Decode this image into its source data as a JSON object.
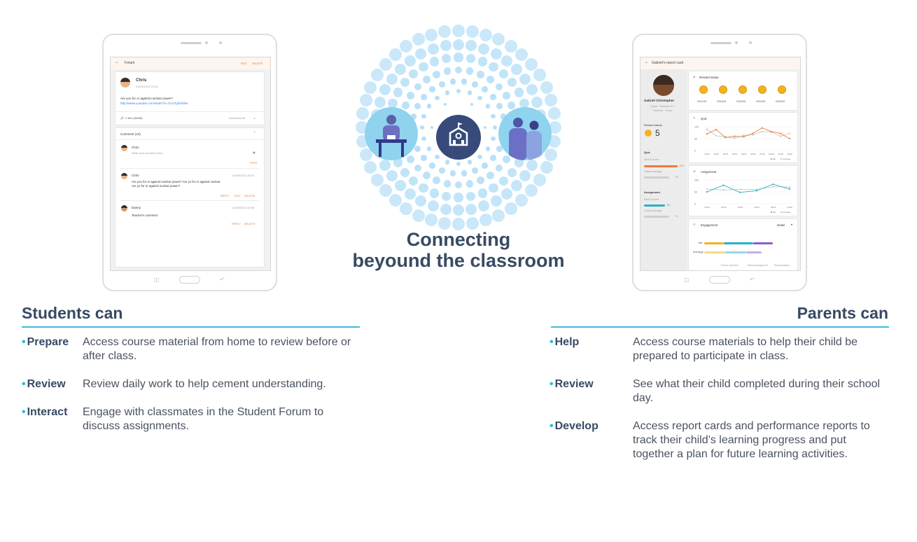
{
  "colors": {
    "accent": "#2dbbd8",
    "heading": "#374a63",
    "orange": "#e07a3f",
    "teal": "#2ab0c4"
  },
  "center": {
    "title_line1": "Connecting",
    "title_line2": "beyound the classroom",
    "icon": "school-icon"
  },
  "left_tablet": {
    "appbar": {
      "title": "Forum",
      "edit": "EDIT",
      "delete": "DELETE"
    },
    "post": {
      "author": "Chris",
      "date": "01/29/2013 19:10",
      "text": "Are you for or against nuclear power?",
      "link": "http://www.youtube.com/watch?v=GcV2ybXi00w",
      "files": "2 files (50MB)",
      "download": "Download all"
    },
    "comments": {
      "header": "Comment (10)",
      "input_name": "Chris",
      "input_placeholder": "Write your comment here",
      "post": "POST",
      "items": [
        {
          "name": "Chris",
          "date": "01/29/2013 19:10",
          "text1": "Are you for or against nuclear power? Are yo for or against nuclear",
          "text2": "Are yo for or against nuclear power?",
          "a1": "REPLY",
          "a2": "EDIT",
          "a3": "DELETE"
        },
        {
          "name": "Danny",
          "date": "01/29/2013 19:50",
          "text1": "Teacher's comment",
          "a1": "REPLY",
          "a2": "DELETE"
        }
      ]
    }
  },
  "right_tablet": {
    "appbar": {
      "title": "Gabriel's report card"
    },
    "profile": {
      "name": "Gabriel Christopher",
      "class": "Class : Science 5-1",
      "teacher": "Teacher : Chris"
    },
    "sidebar": {
      "reward_label": "Reward stamp",
      "reward_count": "5",
      "quiz_label": "Quiz",
      "alex_score": "Alex's score",
      "quiz_score": "100",
      "class_average": "Class average",
      "quiz_avg": "75",
      "assignment_label": "Assignment",
      "assign_score": "50",
      "assign_avg": "73"
    },
    "reward_card": {
      "title": "Reward stamp",
      "dates": [
        "03/14/15",
        "03/16/15",
        "03/16/15",
        "03/16/15",
        "03/16/15"
      ]
    },
    "quiz_card": {
      "title": "Quiz",
      "yticks": [
        "100",
        "50",
        "0"
      ],
      "xticks": [
        "03/14",
        "03/15",
        "03/16",
        "03/16",
        "03/16",
        "03/16",
        "03/16",
        "03/16",
        "03/16",
        "03/16"
      ],
      "legend": [
        "Me",
        "Average"
      ]
    },
    "assignment_card": {
      "title": "Assignment",
      "yticks": [
        "100",
        "50",
        "0"
      ],
      "xticks": [
        "03/14",
        "03/15",
        "03/16",
        "03/16",
        "03/16",
        "03/16"
      ],
      "legend": [
        "Me",
        "Average"
      ]
    },
    "engagement_card": {
      "title": "Engagement",
      "detail": "Detail",
      "row1": "Me",
      "row2": "Average",
      "legend": [
        "Forum comment",
        "Submit assignment",
        "Reward stamp"
      ]
    }
  },
  "students": {
    "title": "Students can",
    "items": [
      {
        "term": "Prepare",
        "desc": "Access course material from home to review before or after class."
      },
      {
        "term": "Review",
        "desc": "Review daily work to help cement understanding."
      },
      {
        "term": "Interact",
        "desc": "Engage with classmates in the Student Forum to discuss assignments."
      }
    ]
  },
  "parents": {
    "title": "Parents can",
    "items": [
      {
        "term": "Help",
        "desc": "Access course materials to help their child be prepared to participate in class."
      },
      {
        "term": "Review",
        "desc": "See what their child completed during their school day."
      },
      {
        "term": "Develop",
        "desc": "Access report cards and performance reports to track their child’s learning progress and put together a plan for future learning activities."
      }
    ]
  }
}
